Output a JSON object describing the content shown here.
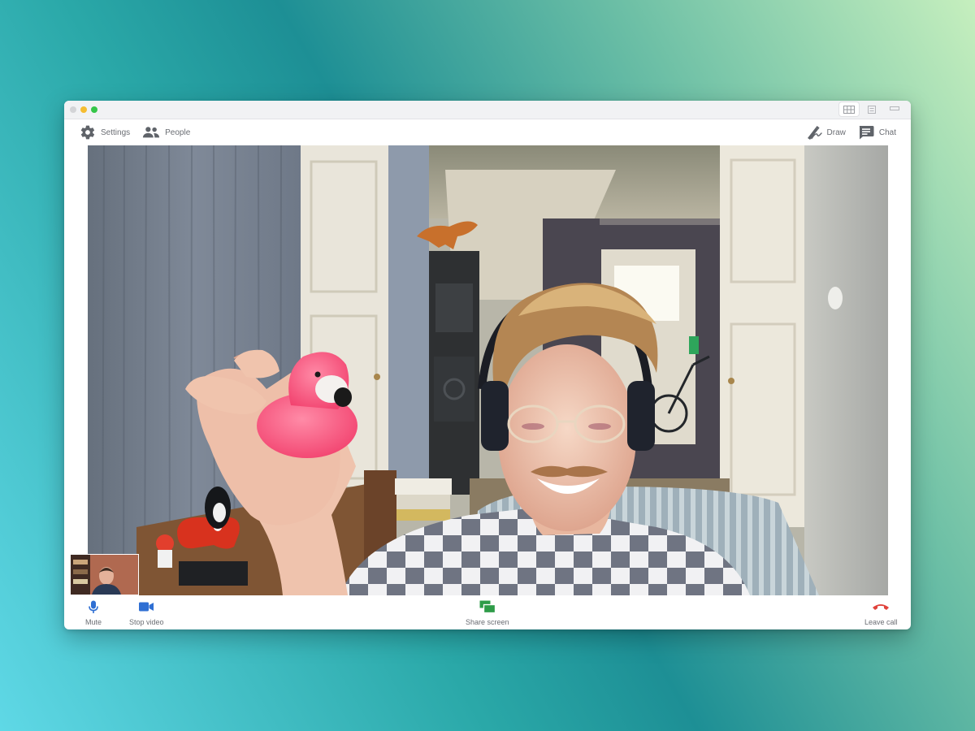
{
  "toolbar": {
    "settings_label": "Settings",
    "people_label": "People",
    "draw_label": "Draw",
    "chat_label": "Chat"
  },
  "controls": {
    "mute_label": "Mute",
    "stop_video_label": "Stop video",
    "share_screen_label": "Share screen",
    "leave_call_label": "Leave call"
  },
  "colors": {
    "mic_blue": "#2f6fd3",
    "camera_blue": "#2f6fd3",
    "share_green": "#2e9c48",
    "leave_red": "#e0433c",
    "icon_gray": "#5f6369"
  },
  "icons": {
    "settings": "gear-icon",
    "people": "people-icon",
    "draw": "pen-icon",
    "chat": "chat-icon",
    "mute": "microphone-icon",
    "stop_video": "video-camera-icon",
    "share_screen": "share-screen-icon",
    "leave_call": "phone-hangup-icon"
  }
}
